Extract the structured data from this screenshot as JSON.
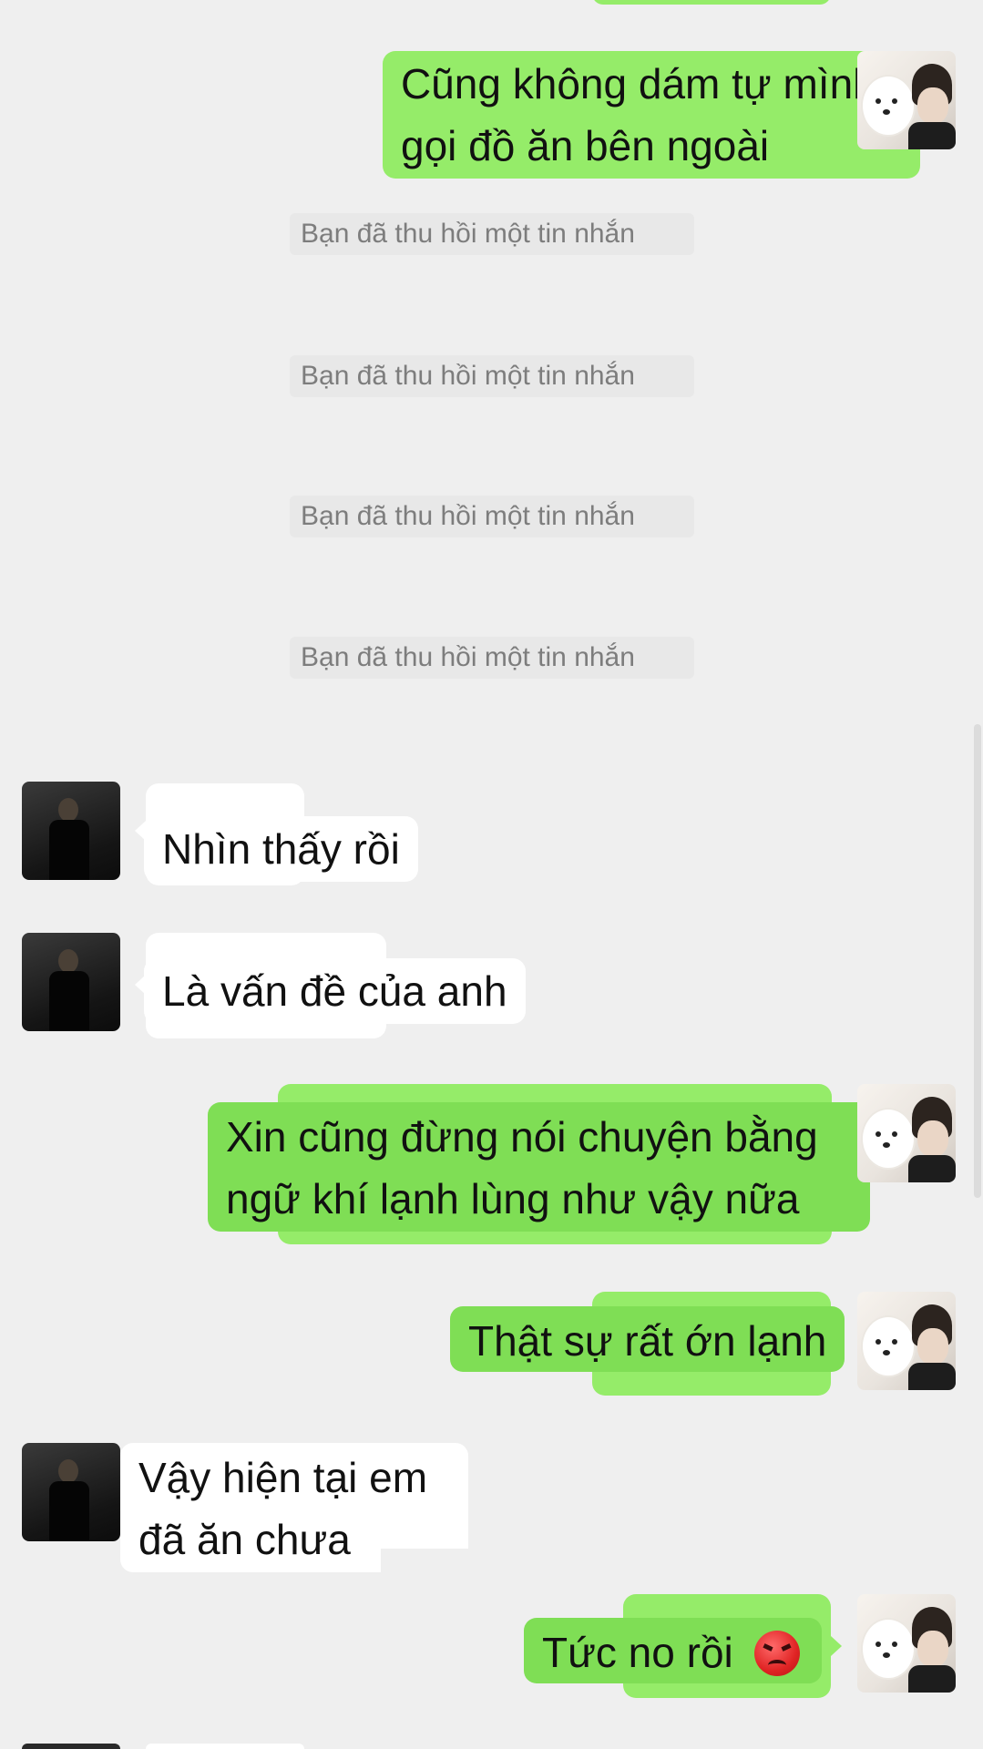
{
  "messages": {
    "m1": {
      "lines": [
        "Cũng không dám tự mình",
        "gọi đồ ăn bên ngoài"
      ]
    },
    "recall_notice": "Bạn đã thu hồi một tin nhắn",
    "m2": {
      "text": "Nhìn thấy rồi"
    },
    "m3": {
      "text": "Là vấn đề của anh"
    },
    "m4": {
      "lines": [
        "Xin cũng đừng nói chuyện bằng",
        "ngữ khí lạnh lùng như vậy nữa"
      ]
    },
    "m5": {
      "text": "Thật sự rất ớn lạnh"
    },
    "m6": {
      "lines": [
        "Vậy hiện tại em",
        "đã ăn chưa"
      ]
    },
    "m7": {
      "text": "Tức no rồi",
      "emoji": "angry-face-icon"
    }
  },
  "colors": {
    "background": "#efefef",
    "outgoing_bubble": "#95ec69",
    "incoming_bubble": "#ffffff",
    "recall_text": "#7d7d7d"
  }
}
